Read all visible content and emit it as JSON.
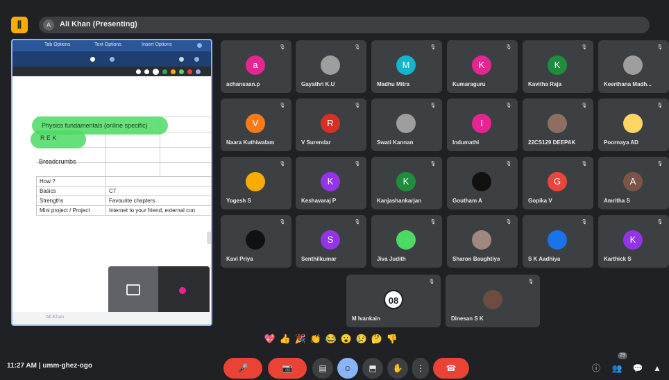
{
  "header": {
    "logo_glyph": "⫼",
    "presenting_label": "Ali Khan (Presenting)",
    "presenter_initial": "A"
  },
  "shared_doc": {
    "tab_labels": [
      "Tab Options",
      "Text Options",
      "Insert Options"
    ],
    "highlight_1": "Physics fundamentals (online specific)",
    "highlight_2": "R E K",
    "breadcrumbs": "Breadcrumbs",
    "table": [
      [
        "How ?",
        ""
      ],
      [
        "Basics",
        "C7"
      ],
      [
        "Strengths",
        "Favourite chapters"
      ],
      [
        "Mini project / Project",
        "Internet to your friend, external con"
      ]
    ],
    "footer_text": "All Khan"
  },
  "participants": [
    {
      "name": "achansaan.p",
      "initial": "a",
      "color": "#e52592"
    },
    {
      "name": "Gayathri K.U",
      "initial": "",
      "color": "#9e9e9e"
    },
    {
      "name": "Madhu Mitra",
      "initial": "M",
      "color": "#12b5cb"
    },
    {
      "name": "Kumaraguru",
      "initial": "K",
      "color": "#e52592"
    },
    {
      "name": "Kavitha Raja",
      "initial": "K",
      "color": "#1e8e3e"
    },
    {
      "name": "Keerthana Madh...",
      "initial": "",
      "color": "#9e9e9e"
    },
    {
      "name": "Naara Kuthiwalam",
      "initial": "V",
      "color": "#fa7b17"
    },
    {
      "name": "V Surendar",
      "initial": "R",
      "color": "#d93025"
    },
    {
      "name": "Swati Kannan",
      "initial": "",
      "color": "#9e9e9e"
    },
    {
      "name": "Indumathi",
      "initial": "I",
      "color": "#e52592"
    },
    {
      "name": "22CS129 DEEPAK",
      "initial": "",
      "color": "#8d6e63"
    },
    {
      "name": "Poornaya AD",
      "initial": "",
      "color": "#fdd663"
    },
    {
      "name": "Yogesh S",
      "initial": "",
      "color": "#f9ab00"
    },
    {
      "name": "Keshavaraj P",
      "initial": "K",
      "color": "#9334e6"
    },
    {
      "name": "Kanjashankarjan",
      "initial": "K",
      "color": "#1e8e3e"
    },
    {
      "name": "Goutham A",
      "initial": "",
      "color": "#111111"
    },
    {
      "name": "Gopika V",
      "initial": "G",
      "color": "#e8453c"
    },
    {
      "name": "Amritha S",
      "initial": "A",
      "color": "#795548"
    },
    {
      "name": "Kavi Priya",
      "initial": "",
      "color": "#111111"
    },
    {
      "name": "Senthilkumar",
      "initial": "S",
      "color": "#9334e6"
    },
    {
      "name": "Jiva Judith",
      "initial": "",
      "color": "#4cd964"
    },
    {
      "name": "Sharon Baughtiya",
      "initial": "",
      "color": "#a1887f"
    },
    {
      "name": "S K Aadhiya",
      "initial": "",
      "color": "#1a73e8"
    },
    {
      "name": "Karthick S",
      "initial": "K",
      "color": "#9334e6"
    },
    {
      "name": "M Ivankain",
      "initial": "08",
      "color": "#ffffff"
    },
    {
      "name": "Dinesan S K",
      "initial": "",
      "color": "#6d4c41"
    }
  ],
  "reactions": [
    "💖",
    "👍",
    "🎉",
    "👏",
    "😂",
    "😮",
    "😢",
    "🤔",
    "👎"
  ],
  "bottom_bar": {
    "time_meeting": "11:27 AM  |  umm-ghez-ogo",
    "mic_glyph": "🎤",
    "cam_glyph": "📷",
    "cc_glyph": "▤",
    "emoji_glyph": "☺",
    "present_glyph": "⬒",
    "hand_glyph": "✋",
    "more_glyph": "⋮",
    "end_glyph": "☎",
    "info_glyph": "ⓘ",
    "people_glyph": "👥",
    "people_count": "29",
    "chat_glyph": "💬",
    "activities_glyph": "▲"
  }
}
